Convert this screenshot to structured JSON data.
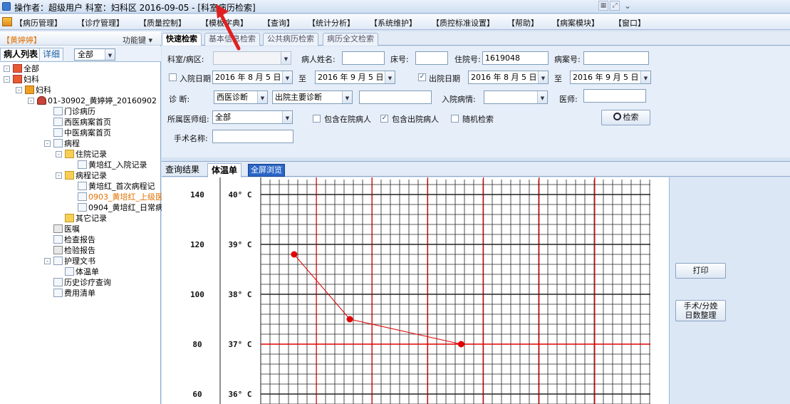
{
  "window": {
    "title": "操作者：超级用户  科室：妇科区  2016-09-05 - [科室病历检索]"
  },
  "menu": [
    "【病历管理】",
    "【诊疗管理】",
    "【质量控制】",
    "【模板字典】",
    "【查询】",
    "【统计分析】",
    "【系统维护】",
    "【质控标准设置】",
    "【帮助】",
    "【病案模块】",
    "【窗口】"
  ],
  "left": {
    "user": "【黄婷婷】",
    "func_key": "功能键 ▾",
    "tab_patients": "病人列表",
    "tab_detail": "详细",
    "filter_value": "全部",
    "tree": [
      {
        "label": "全部",
        "icon": "red"
      },
      {
        "label": "妇科",
        "icon": "red"
      },
      {
        "label": "妇科",
        "icon": "ward"
      },
      {
        "label": "01-30902_黄婷婷_20160902",
        "icon": "user"
      },
      {
        "label": "门诊病历",
        "icon": "doc"
      },
      {
        "label": "西医病案首页",
        "icon": "doc"
      },
      {
        "label": "中医病案首页",
        "icon": "doc"
      },
      {
        "label": "病程",
        "icon": "doc"
      },
      {
        "label": "住院记录",
        "icon": "folder"
      },
      {
        "label": "黄培红_入院记录",
        "icon": "doc"
      },
      {
        "label": "病程记录",
        "icon": "folder"
      },
      {
        "label": "黄培红_首次病程记",
        "icon": "doc"
      },
      {
        "label": "0903_黄培红_上级医",
        "icon": "doc"
      },
      {
        "label": "0904_黄培红_日常病",
        "icon": "doc"
      },
      {
        "label": "其它记录",
        "icon": "folder"
      },
      {
        "label": "医嘱",
        "icon": "pen"
      },
      {
        "label": "检查报告",
        "icon": "doc"
      },
      {
        "label": "检验报告",
        "icon": "pen"
      },
      {
        "label": "护理文书",
        "icon": "doc"
      },
      {
        "label": "体温单",
        "icon": "doc"
      },
      {
        "label": "历史诊疗查询",
        "icon": "doc"
      },
      {
        "label": "费用清单",
        "icon": "doc"
      }
    ]
  },
  "search_tabs": [
    "快速检索",
    "基本信息检索",
    "公共病历检索",
    "病历全文检索"
  ],
  "form": {
    "dept_label": "科室/病区:",
    "dept_value": "",
    "patient_name_label": "病人姓名:",
    "patient_name_value": "",
    "bed_label": "床号:",
    "bed_value": "",
    "inpatient_no_label": "住院号:",
    "inpatient_no_value": "1619048",
    "case_no_label": "病案号:",
    "case_no_value": "",
    "admit_date_label": "入院日期",
    "admit_from": "2016 年 8 月 5 日",
    "to_label_1": "至",
    "admit_to": "2016 年 9 月 5 日",
    "discharge_date_label": "出院日期",
    "discharge_from": "2016 年 8 月 5 日",
    "to_label_2": "至",
    "discharge_to": "2016 年 9 月 5 日",
    "diag_label": "诊    断:",
    "diag_type": "西医诊断",
    "diag_scope": "出院主要诊断",
    "diag_text": "",
    "admit_condition_label": "入院病情:",
    "admit_condition_value": "",
    "doctor_label": "医师:",
    "doctor_value": "",
    "doctor_group_label": "所属医师组:",
    "doctor_group_value": "全部",
    "include_inpatient_label": "包含在院病人",
    "include_discharged_label": "包含出院病人",
    "random_label": "随机检索",
    "search_button": "检索",
    "surgery_label": "手术名称:",
    "surgery_value": ""
  },
  "result_tabs": {
    "results": "查询结果",
    "temp_chart": "体温单",
    "fullscreen": "全屏浏览"
  },
  "right": {
    "print_button": "打印",
    "surgery_days_line1": "手术/分娩",
    "surgery_days_line2": "日数整理"
  },
  "chart_data": {
    "type": "line",
    "pulse_ticks": [
      "140",
      "120",
      "100",
      "80",
      "60"
    ],
    "temp_ticks": [
      "40° C",
      "39° C",
      "38° C",
      "37° C",
      "36° C"
    ],
    "temp_range": [
      35.8,
      40.3
    ],
    "series": [
      {
        "color": "#e00000",
        "values": [
          38.8,
          37.5,
          37.0
        ]
      }
    ],
    "point_day_index": [
      0.6,
      1.6,
      3.6
    ]
  }
}
